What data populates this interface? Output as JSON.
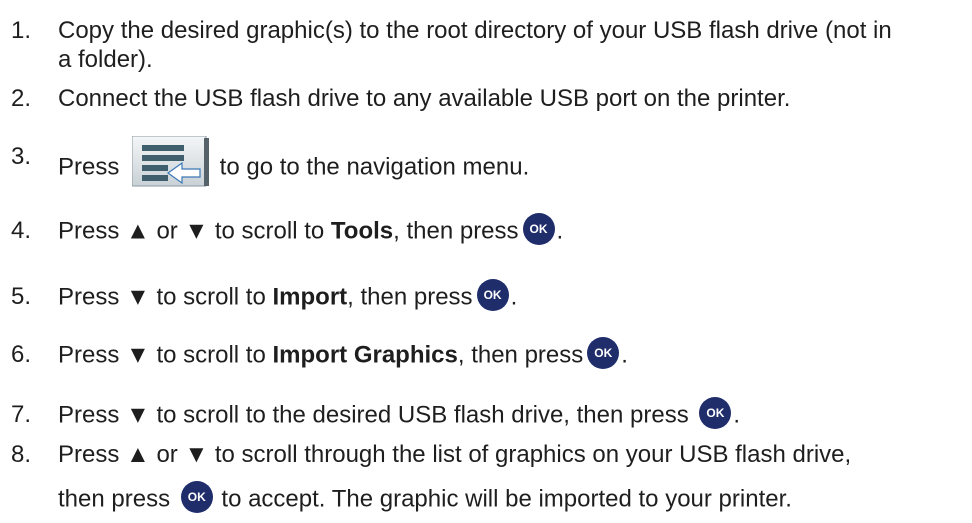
{
  "steps": [
    {
      "num": "1.",
      "text": "Copy the desired graphic(s) to the root directory of your USB flash drive (not in",
      "text2": "a folder)."
    },
    {
      "num": "2.",
      "text": "Connect the USB flash drive to any available USB port on the printer."
    },
    {
      "num": "3.",
      "pre": "Press",
      "post": "to go to the navigation menu.",
      "icon": "navigation-menu-icon"
    },
    {
      "num": "4.",
      "pre": "Press ▲ or ▼ to scroll to ",
      "bold": "Tools",
      "mid": ", then press",
      "post": ".",
      "ok": "OK"
    },
    {
      "num": "5.",
      "pre": "Press ▼ to scroll to ",
      "bold": "Import",
      "mid": ", then press",
      "post": ".",
      "ok": "OK"
    },
    {
      "num": "6.",
      "pre": "Press ▼ to scroll to ",
      "bold": "Import Graphics",
      "mid": ", then press",
      "post": ".",
      "ok": "OK"
    },
    {
      "num": "7.",
      "pre": "Press ▼ to scroll to the desired USB flash drive, then press",
      "post": ".",
      "ok": "OK"
    },
    {
      "num": "8.",
      "text": "Press ▲ or ▼ to scroll through the list of graphics on your USB flash drive,",
      "line2_pre": "then press",
      "line2_post": "to accept. The graphic will be imported to your printer.",
      "ok": "OK"
    }
  ],
  "colors": {
    "text": "#1e1e1e",
    "ok_button": "#1f2d6b",
    "nav_icon_dark": "#3f5f6f",
    "nav_icon_arrow": "#3a78b5"
  }
}
